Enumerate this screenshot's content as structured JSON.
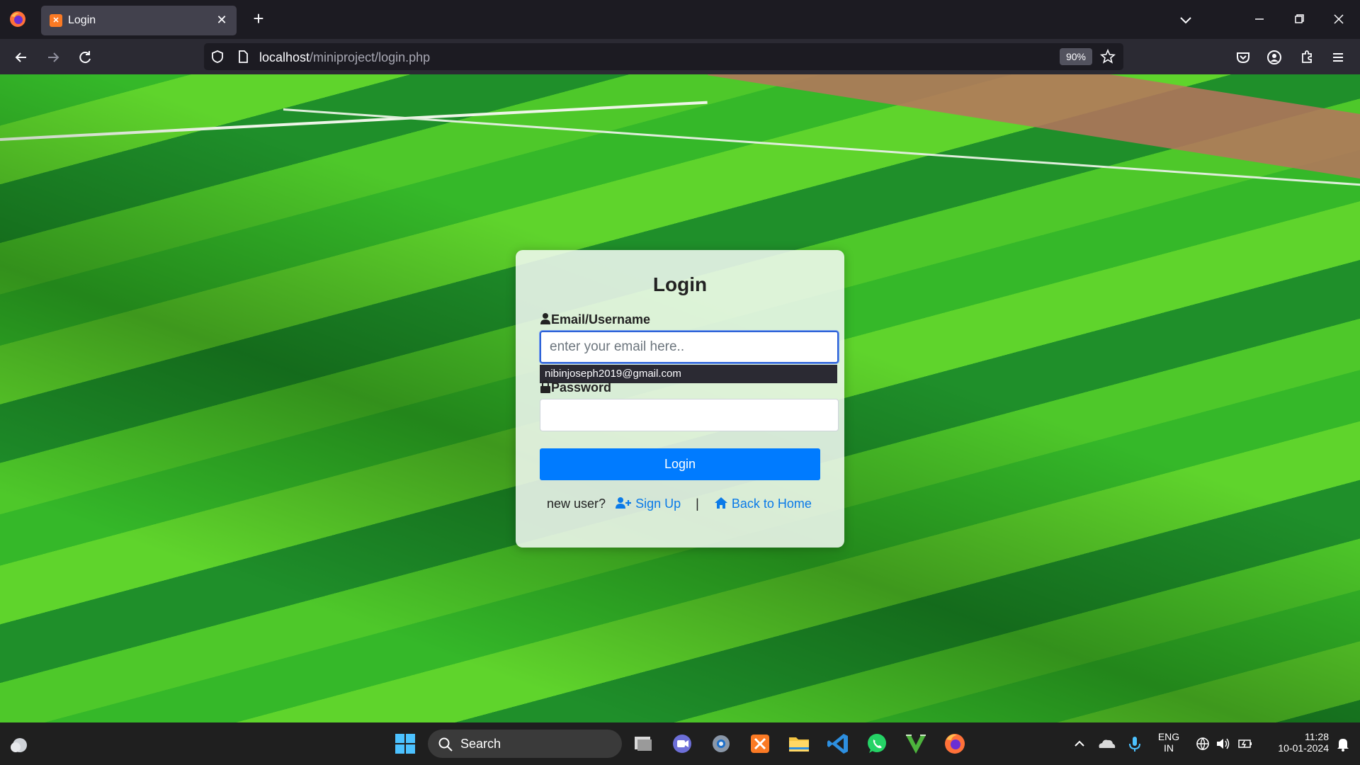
{
  "browser": {
    "tab": {
      "title": "Login",
      "favicon_text": "✕"
    },
    "url": {
      "host": "localhost",
      "path": "/miniproject/login.php"
    },
    "zoom": "90%"
  },
  "login": {
    "title": "Login",
    "email_label": "Email/Username",
    "email_placeholder": "enter your email here..",
    "autocomplete_suggestion": "nibinjoseph2019@gmail.com",
    "password_label": "Password",
    "password_value": "",
    "login_button": "Login",
    "new_user_text": "new user?",
    "signup_link": "Sign Up",
    "separator": "|",
    "home_link": "Back to Home",
    "primary_color": "#007bff"
  },
  "taskbar": {
    "search_label": "Search",
    "lang_top": "ENG",
    "lang_bottom": "IN",
    "time": "11:28",
    "date": "10-01-2024"
  }
}
